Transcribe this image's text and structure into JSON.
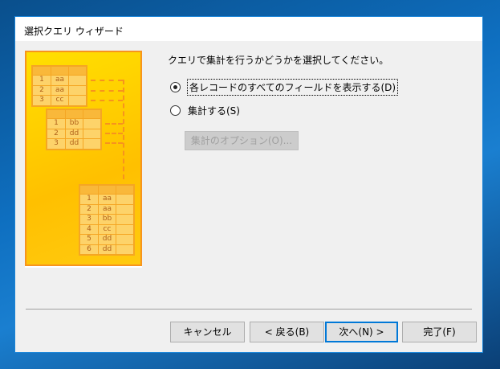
{
  "window": {
    "title": "選択クエリ ウィザード"
  },
  "prompt": "クエリで集計を行うかどうかを選択してください。",
  "options": [
    {
      "label": "各レコードのすべてのフィールドを表示する(D)",
      "selected": true
    },
    {
      "label": "集計する(S)",
      "selected": false
    }
  ],
  "summary_options_button": "集計のオプション(O)...",
  "buttons": {
    "cancel": "キャンセル",
    "back": "< 戻る(B)",
    "next": "次へ(N) >",
    "finish": "完了(F)"
  },
  "illustration": {
    "table1": [
      [
        "1",
        "aa"
      ],
      [
        "2",
        "aa"
      ],
      [
        "3",
        "cc"
      ]
    ],
    "table2": [
      [
        "1",
        "bb"
      ],
      [
        "2",
        "dd"
      ],
      [
        "3",
        "dd"
      ]
    ],
    "table3": [
      [
        "1",
        "aa"
      ],
      [
        "2",
        "aa"
      ],
      [
        "3",
        "bb"
      ],
      [
        "4",
        "cc"
      ],
      [
        "5",
        "dd"
      ],
      [
        "6",
        "dd"
      ]
    ]
  }
}
